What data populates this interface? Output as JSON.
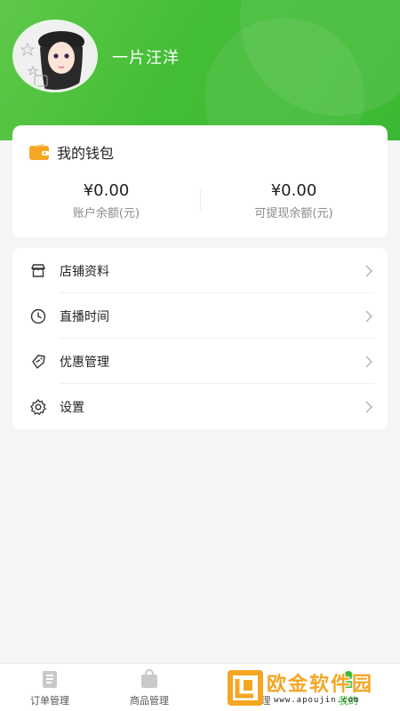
{
  "profile": {
    "username": "一片汪洋"
  },
  "wallet": {
    "title": "我的钱包",
    "balances": [
      {
        "amount": "¥0.00",
        "label": "账户余额(元)"
      },
      {
        "amount": "¥0.00",
        "label": "可提现余额(元)"
      }
    ]
  },
  "menu": {
    "items": [
      {
        "label": "店铺资料",
        "icon": "store-icon"
      },
      {
        "label": "直播时间",
        "icon": "clock-icon"
      },
      {
        "label": "优惠管理",
        "icon": "coupon-icon"
      },
      {
        "label": "设置",
        "icon": "gear-icon"
      }
    ]
  },
  "tabbar": {
    "tabs": [
      {
        "label": "订单管理",
        "icon": "order-icon"
      },
      {
        "label": "商品管理",
        "icon": "bag-icon"
      },
      {
        "label": "理",
        "icon": "manage-icon"
      },
      {
        "label": "我的",
        "icon": "profile-icon"
      }
    ],
    "active_index": 3
  },
  "watermark": {
    "brand": "欧金软件园",
    "url": "www.apoujin.com"
  },
  "colors": {
    "brand_green": "#44bd36",
    "wallet_orange": "#f5a623",
    "text_primary": "#222222",
    "text_secondary": "#8a8a8a"
  }
}
